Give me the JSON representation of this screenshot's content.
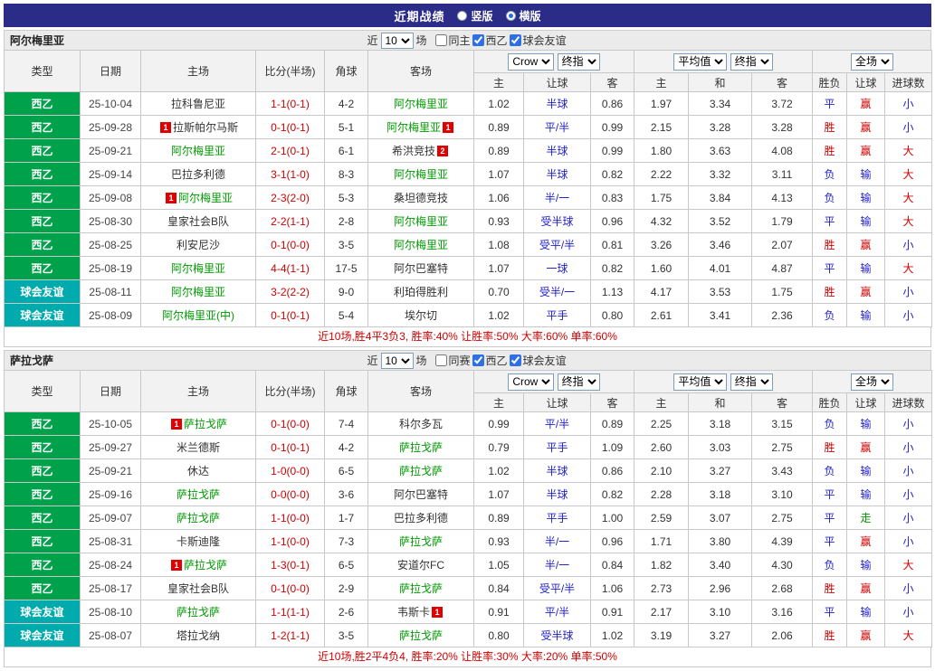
{
  "colors": {
    "topbar_bg": "#2b2b88",
    "league_badge_green": "#00a14b",
    "friendly_badge_teal": "#00aaad",
    "focus_team_green": "#009900",
    "result_red": "#d10000",
    "result_blue": "#2222cc",
    "walk_green": "#009900",
    "red_card_badge": "#e00000"
  },
  "topbar": {
    "title": "近期战绩",
    "view_options": [
      {
        "label": "竖版",
        "selected": false
      },
      {
        "label": "横版",
        "selected": true
      }
    ]
  },
  "sections": [
    {
      "team": "阿尔梅里亚",
      "filter": {
        "prefix": "近",
        "count": "10",
        "suffix": "场",
        "checkboxes": [
          {
            "label": "同主",
            "checked": false
          },
          {
            "label": "西乙",
            "checked": true
          },
          {
            "label": "球会友谊",
            "checked": true
          }
        ]
      },
      "header": {
        "type": "类型",
        "date": "日期",
        "home": "主场",
        "score": "比分(半场)",
        "corner": "角球",
        "away": "客场",
        "company_select": "Crow",
        "final_select_1": "终指",
        "avg_select": "平均值",
        "final_select_2": "终指",
        "scope_select": "全场",
        "sub": [
          "主",
          "让球",
          "客",
          "主",
          "和",
          "客",
          "胜负",
          "让球",
          "进球数"
        ]
      },
      "rows": [
        {
          "type": "西乙",
          "type_style": "league",
          "date": "25-10-04",
          "home": {
            "name": "拉科鲁尼亚",
            "focus": false
          },
          "score": "1-1(0-1)",
          "corners": "4-2",
          "away": {
            "name": "阿尔梅里亚",
            "focus": true
          },
          "odds": [
            "1.02",
            "半球",
            "0.86"
          ],
          "avg": [
            "1.97",
            "3.34",
            "3.72"
          ],
          "outcome": {
            "wl": "平",
            "wl_c": "blue",
            "hc": "赢",
            "hc_c": "red",
            "goal": "小",
            "goal_c": "blue"
          }
        },
        {
          "type": "西乙",
          "type_style": "league",
          "date": "25-09-28",
          "home": {
            "name": "拉斯帕尔马斯",
            "focus": false,
            "card_pre": "1"
          },
          "score": "0-1(0-1)",
          "corners": "5-1",
          "away": {
            "name": "阿尔梅里亚",
            "focus": true,
            "card_post": "1"
          },
          "odds": [
            "0.89",
            "平/半",
            "0.99"
          ],
          "avg": [
            "2.15",
            "3.28",
            "3.28"
          ],
          "outcome": {
            "wl": "胜",
            "wl_c": "red",
            "hc": "赢",
            "hc_c": "red",
            "goal": "小",
            "goal_c": "blue"
          }
        },
        {
          "type": "西乙",
          "type_style": "league",
          "date": "25-09-21",
          "home": {
            "name": "阿尔梅里亚",
            "focus": true
          },
          "score": "2-1(0-1)",
          "corners": "6-1",
          "away": {
            "name": "希洪竞技",
            "focus": false,
            "card_post": "2"
          },
          "odds": [
            "0.89",
            "半球",
            "0.99"
          ],
          "avg": [
            "1.80",
            "3.63",
            "4.08"
          ],
          "outcome": {
            "wl": "胜",
            "wl_c": "red",
            "hc": "赢",
            "hc_c": "red",
            "goal": "大",
            "goal_c": "red"
          }
        },
        {
          "type": "西乙",
          "type_style": "league",
          "date": "25-09-14",
          "home": {
            "name": "巴拉多利德",
            "focus": false
          },
          "score": "3-1(1-0)",
          "corners": "8-3",
          "away": {
            "name": "阿尔梅里亚",
            "focus": true
          },
          "odds": [
            "1.07",
            "半球",
            "0.82"
          ],
          "avg": [
            "2.22",
            "3.32",
            "3.11"
          ],
          "outcome": {
            "wl": "负",
            "wl_c": "blue",
            "hc": "输",
            "hc_c": "blue",
            "goal": "大",
            "goal_c": "red"
          }
        },
        {
          "type": "西乙",
          "type_style": "league",
          "date": "25-09-08",
          "home": {
            "name": "阿尔梅里亚",
            "focus": true,
            "card_pre": "1"
          },
          "score": "2-3(2-0)",
          "corners": "5-3",
          "away": {
            "name": "桑坦德竞技",
            "focus": false
          },
          "odds": [
            "1.06",
            "半/一",
            "0.83"
          ],
          "avg": [
            "1.75",
            "3.84",
            "4.13"
          ],
          "outcome": {
            "wl": "负",
            "wl_c": "blue",
            "hc": "输",
            "hc_c": "blue",
            "goal": "大",
            "goal_c": "red"
          }
        },
        {
          "type": "西乙",
          "type_style": "league",
          "date": "25-08-30",
          "home": {
            "name": "皇家社会B队",
            "focus": false
          },
          "score": "2-2(1-1)",
          "corners": "2-8",
          "away": {
            "name": "阿尔梅里亚",
            "focus": true
          },
          "odds": [
            "0.93",
            "受半球",
            "0.96"
          ],
          "avg": [
            "4.32",
            "3.52",
            "1.79"
          ],
          "outcome": {
            "wl": "平",
            "wl_c": "blue",
            "hc": "输",
            "hc_c": "blue",
            "goal": "大",
            "goal_c": "red"
          }
        },
        {
          "type": "西乙",
          "type_style": "league",
          "date": "25-08-25",
          "home": {
            "name": "利安尼沙",
            "focus": false
          },
          "score": "0-1(0-0)",
          "corners": "3-5",
          "away": {
            "name": "阿尔梅里亚",
            "focus": true
          },
          "odds": [
            "1.08",
            "受平/半",
            "0.81"
          ],
          "avg": [
            "3.26",
            "3.46",
            "2.07"
          ],
          "outcome": {
            "wl": "胜",
            "wl_c": "red",
            "hc": "赢",
            "hc_c": "red",
            "goal": "小",
            "goal_c": "blue"
          }
        },
        {
          "type": "西乙",
          "type_style": "league",
          "date": "25-08-19",
          "home": {
            "name": "阿尔梅里亚",
            "focus": true
          },
          "score": "4-4(1-1)",
          "corners": "17-5",
          "away": {
            "name": "阿尔巴塞特",
            "focus": false
          },
          "odds": [
            "1.07",
            "一球",
            "0.82"
          ],
          "avg": [
            "1.60",
            "4.01",
            "4.87"
          ],
          "outcome": {
            "wl": "平",
            "wl_c": "blue",
            "hc": "输",
            "hc_c": "blue",
            "goal": "大",
            "goal_c": "red"
          }
        },
        {
          "type": "球会友谊",
          "type_style": "friendly",
          "date": "25-08-11",
          "home": {
            "name": "阿尔梅里亚",
            "focus": true
          },
          "score": "3-2(2-2)",
          "corners": "9-0",
          "away": {
            "name": "利珀得胜利",
            "focus": false
          },
          "odds": [
            "0.70",
            "受半/一",
            "1.13"
          ],
          "avg": [
            "4.17",
            "3.53",
            "1.75"
          ],
          "outcome": {
            "wl": "胜",
            "wl_c": "red",
            "hc": "赢",
            "hc_c": "red",
            "goal": "小",
            "goal_c": "blue"
          }
        },
        {
          "type": "球会友谊",
          "type_style": "friendly",
          "date": "25-08-09",
          "home": {
            "name": "阿尔梅里亚(中)",
            "focus": true
          },
          "score": "0-1(0-1)",
          "corners": "5-4",
          "away": {
            "name": "埃尔切",
            "focus": false
          },
          "odds": [
            "1.02",
            "平手",
            "0.80"
          ],
          "avg": [
            "2.61",
            "3.41",
            "2.36"
          ],
          "outcome": {
            "wl": "负",
            "wl_c": "blue",
            "hc": "输",
            "hc_c": "blue",
            "goal": "小",
            "goal_c": "blue"
          }
        }
      ],
      "summary": "近10场,胜4平3负3, 胜率:40% 让胜率:50% 大率:60% 单率:60%"
    },
    {
      "team": "萨拉戈萨",
      "filter": {
        "prefix": "近",
        "count": "10",
        "suffix": "场",
        "checkboxes": [
          {
            "label": "同赛",
            "checked": false
          },
          {
            "label": "西乙",
            "checked": true
          },
          {
            "label": "球会友谊",
            "checked": true
          }
        ]
      },
      "header": {
        "type": "类型",
        "date": "日期",
        "home": "主场",
        "score": "比分(半场)",
        "corner": "角球",
        "away": "客场",
        "company_select": "Crow",
        "final_select_1": "终指",
        "avg_select": "平均值",
        "final_select_2": "终指",
        "scope_select": "全场",
        "sub": [
          "主",
          "让球",
          "客",
          "主",
          "和",
          "客",
          "胜负",
          "让球",
          "进球数"
        ]
      },
      "rows": [
        {
          "type": "西乙",
          "type_style": "league",
          "date": "25-10-05",
          "home": {
            "name": "萨拉戈萨",
            "focus": true,
            "card_pre": "1"
          },
          "score": "0-1(0-0)",
          "corners": "7-4",
          "away": {
            "name": "科尔多瓦",
            "focus": false
          },
          "odds": [
            "0.99",
            "平/半",
            "0.89"
          ],
          "avg": [
            "2.25",
            "3.18",
            "3.15"
          ],
          "outcome": {
            "wl": "负",
            "wl_c": "blue",
            "hc": "输",
            "hc_c": "blue",
            "goal": "小",
            "goal_c": "blue"
          }
        },
        {
          "type": "西乙",
          "type_style": "league",
          "date": "25-09-27",
          "home": {
            "name": "米兰德斯",
            "focus": false
          },
          "score": "0-1(0-1)",
          "corners": "4-2",
          "away": {
            "name": "萨拉戈萨",
            "focus": true
          },
          "odds": [
            "0.79",
            "平手",
            "1.09"
          ],
          "avg": [
            "2.60",
            "3.03",
            "2.75"
          ],
          "outcome": {
            "wl": "胜",
            "wl_c": "red",
            "hc": "赢",
            "hc_c": "red",
            "goal": "小",
            "goal_c": "blue"
          }
        },
        {
          "type": "西乙",
          "type_style": "league",
          "date": "25-09-21",
          "home": {
            "name": "休达",
            "focus": false
          },
          "score": "1-0(0-0)",
          "corners": "6-5",
          "away": {
            "name": "萨拉戈萨",
            "focus": true
          },
          "odds": [
            "1.02",
            "半球",
            "0.86"
          ],
          "avg": [
            "2.10",
            "3.27",
            "3.43"
          ],
          "outcome": {
            "wl": "负",
            "wl_c": "blue",
            "hc": "输",
            "hc_c": "blue",
            "goal": "小",
            "goal_c": "blue"
          }
        },
        {
          "type": "西乙",
          "type_style": "league",
          "date": "25-09-16",
          "home": {
            "name": "萨拉戈萨",
            "focus": true
          },
          "score": "0-0(0-0)",
          "corners": "3-6",
          "away": {
            "name": "阿尔巴塞特",
            "focus": false
          },
          "odds": [
            "1.07",
            "半球",
            "0.82"
          ],
          "avg": [
            "2.28",
            "3.18",
            "3.10"
          ],
          "outcome": {
            "wl": "平",
            "wl_c": "blue",
            "hc": "输",
            "hc_c": "blue",
            "goal": "小",
            "goal_c": "blue"
          }
        },
        {
          "type": "西乙",
          "type_style": "league",
          "date": "25-09-07",
          "home": {
            "name": "萨拉戈萨",
            "focus": true
          },
          "score": "1-1(0-0)",
          "corners": "1-7",
          "away": {
            "name": "巴拉多利德",
            "focus": false
          },
          "odds": [
            "0.89",
            "平手",
            "1.00"
          ],
          "avg": [
            "2.59",
            "3.07",
            "2.75"
          ],
          "outcome": {
            "wl": "平",
            "wl_c": "blue",
            "hc": "走",
            "hc_c": "green",
            "goal": "小",
            "goal_c": "blue"
          }
        },
        {
          "type": "西乙",
          "type_style": "league",
          "date": "25-08-31",
          "home": {
            "name": "卡斯迪隆",
            "focus": false
          },
          "score": "1-1(0-0)",
          "corners": "7-3",
          "away": {
            "name": "萨拉戈萨",
            "focus": true
          },
          "odds": [
            "0.93",
            "半/一",
            "0.96"
          ],
          "avg": [
            "1.71",
            "3.80",
            "4.39"
          ],
          "outcome": {
            "wl": "平",
            "wl_c": "blue",
            "hc": "赢",
            "hc_c": "red",
            "goal": "小",
            "goal_c": "blue"
          }
        },
        {
          "type": "西乙",
          "type_style": "league",
          "date": "25-08-24",
          "home": {
            "name": "萨拉戈萨",
            "focus": true,
            "card_pre": "1"
          },
          "score": "1-3(0-1)",
          "corners": "6-5",
          "away": {
            "name": "安道尔FC",
            "focus": false
          },
          "odds": [
            "1.05",
            "半/一",
            "0.84"
          ],
          "avg": [
            "1.82",
            "3.40",
            "4.30"
          ],
          "outcome": {
            "wl": "负",
            "wl_c": "blue",
            "hc": "输",
            "hc_c": "blue",
            "goal": "大",
            "goal_c": "red"
          }
        },
        {
          "type": "西乙",
          "type_style": "league",
          "date": "25-08-17",
          "home": {
            "name": "皇家社会B队",
            "focus": false
          },
          "score": "0-1(0-0)",
          "corners": "2-9",
          "away": {
            "name": "萨拉戈萨",
            "focus": true
          },
          "odds": [
            "0.84",
            "受平/半",
            "1.06"
          ],
          "avg": [
            "2.73",
            "2.96",
            "2.68"
          ],
          "outcome": {
            "wl": "胜",
            "wl_c": "red",
            "hc": "赢",
            "hc_c": "red",
            "goal": "小",
            "goal_c": "blue"
          }
        },
        {
          "type": "球会友谊",
          "type_style": "friendly",
          "date": "25-08-10",
          "home": {
            "name": "萨拉戈萨",
            "focus": true
          },
          "score": "1-1(1-1)",
          "corners": "2-6",
          "away": {
            "name": "韦斯卡",
            "focus": false,
            "card_post": "1"
          },
          "odds": [
            "0.91",
            "平/半",
            "0.91"
          ],
          "avg": [
            "2.17",
            "3.10",
            "3.16"
          ],
          "outcome": {
            "wl": "平",
            "wl_c": "blue",
            "hc": "输",
            "hc_c": "blue",
            "goal": "小",
            "goal_c": "blue"
          }
        },
        {
          "type": "球会友谊",
          "type_style": "friendly",
          "date": "25-08-07",
          "home": {
            "name": "塔拉戈纳",
            "focus": false
          },
          "score": "1-2(1-1)",
          "corners": "3-5",
          "away": {
            "name": "萨拉戈萨",
            "focus": true
          },
          "odds": [
            "0.80",
            "受半球",
            "1.02"
          ],
          "avg": [
            "3.19",
            "3.27",
            "2.06"
          ],
          "outcome": {
            "wl": "胜",
            "wl_c": "red",
            "hc": "赢",
            "hc_c": "red",
            "goal": "大",
            "goal_c": "red"
          }
        }
      ],
      "summary": "近10场,胜2平4负4, 胜率:20% 让胜率:30% 大率:20% 单率:50%"
    }
  ]
}
